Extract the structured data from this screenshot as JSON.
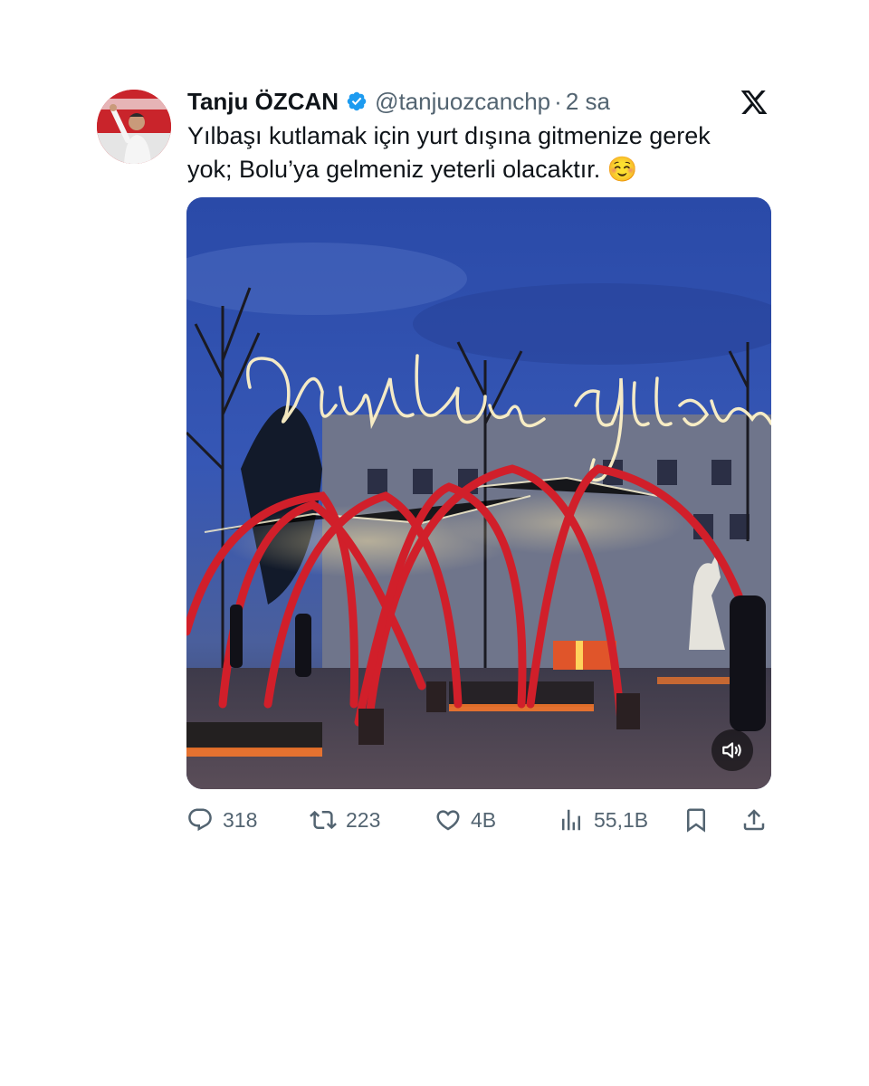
{
  "tweet": {
    "author": {
      "display_name": "Tanju ÖZCAN",
      "handle": "@tanjuozcanchp",
      "verified": true,
      "avatar_icon": "profile-photo"
    },
    "separator": "·",
    "time": "2 sa",
    "text_line1": "Yılbaşı kutlamak için yurt dışına gitmenize gerek",
    "text_line2": "yok; Bolu’ya gelmeniz yeterli olacaktır. ☺️",
    "media": {
      "type": "video",
      "sign_text": "Mutlu Yıllar",
      "mute_icon": "speaker-icon"
    },
    "stats": {
      "replies": "318",
      "retweets": "223",
      "likes": "4B",
      "views": "55,1B"
    }
  },
  "platform": {
    "logo": "x-logo"
  },
  "colors": {
    "text": "#0f1419",
    "secondary": "#536471",
    "verified": "#1d9bf0",
    "arch_red": "#d11f2a"
  }
}
